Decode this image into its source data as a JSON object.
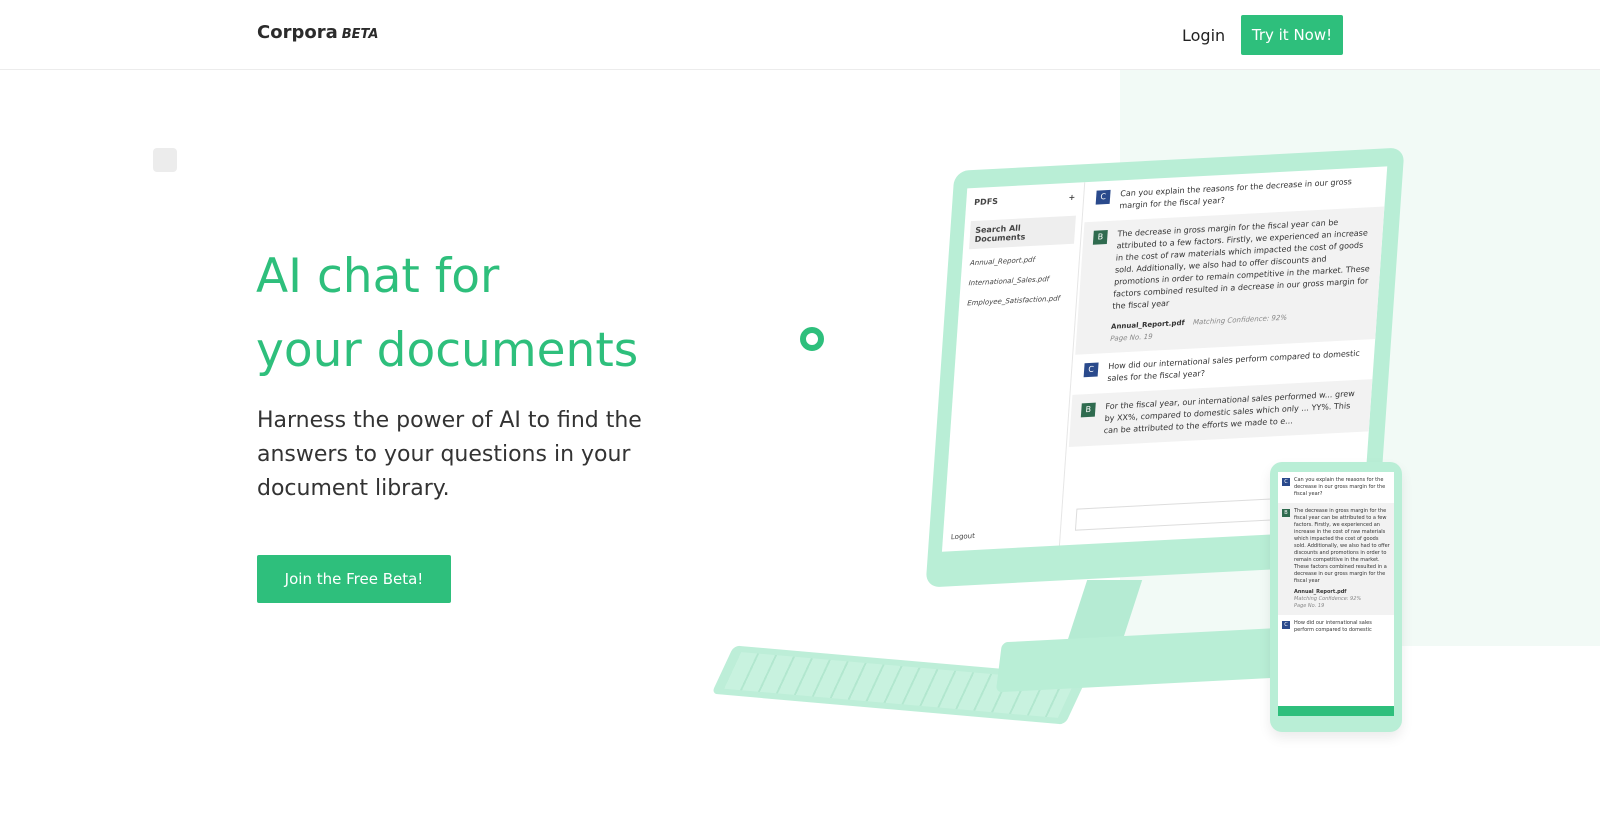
{
  "nav": {
    "brand": "Corpora",
    "beta": "BETA",
    "login": "Login",
    "try_now": "Try it Now!"
  },
  "hero": {
    "title_line1": "AI chat for",
    "title_line2": "your documents",
    "subtitle": "Harness the power of AI to find the answers to your questions in your document library.",
    "cta": "Join the Free Beta!"
  },
  "monitor": {
    "sidebar": {
      "title": "PDFS",
      "add": "+",
      "search": "Search All Documents",
      "docs": [
        "Annual_Report.pdf",
        "International_Sales.pdf",
        "Employee_Satisfaction.pdf"
      ],
      "logout": "Logout"
    },
    "messages": [
      {
        "avatar": "C",
        "text": "Can you explain the reasons for the decrease in our gross margin for the fiscal year?"
      },
      {
        "avatar": "B",
        "text": "The decrease in gross margin for the fiscal year can be attributed to a few factors. Firstly, we experienced an increase in the cost of raw materials which impacted the cost of goods sold. Additionally, we also had to offer discounts and promotions in order to remain competitive in the market. These factors combined resulted in a decrease in our gross margin for the fiscal year",
        "source": "Annual_Report.pdf",
        "confidence": "Matching Confidence: 92%",
        "page": "Page No. 19"
      },
      {
        "avatar": "C",
        "text": "How did our international sales perform compared to domestic sales for the fiscal year?"
      },
      {
        "avatar": "B",
        "text": "For the fiscal year, our international sales performed w... grew by XX%, compared to domestic sales which only ... YY%. This can be attributed to the efforts we made to e..."
      }
    ]
  },
  "phone": {
    "messages": [
      {
        "avatar": "C",
        "text": "Can you explain the reasons for the decrease in our gross margin for the fiscal year?"
      },
      {
        "avatar": "B",
        "text": "The decrease in gross margin for the fiscal year can be attributed to a few factors. Firstly, we experienced an increase in the cost of raw materials which impacted the cost of goods sold. Additionally, we also had to offer discounts and promotions in order to remain competitive in the market. These factors combined resulted in a decrease in our gross margin for the fiscal year",
        "source": "Annual_Report.pdf",
        "confidence": "Matching Confidence: 92%",
        "page": "Page No. 19"
      },
      {
        "avatar": "C",
        "text": "How did our international sales perform compared to domestic"
      }
    ]
  },
  "colors": {
    "accent": "#2ebf7c",
    "device": "#b9eed6",
    "panel": "#f2faf6"
  }
}
